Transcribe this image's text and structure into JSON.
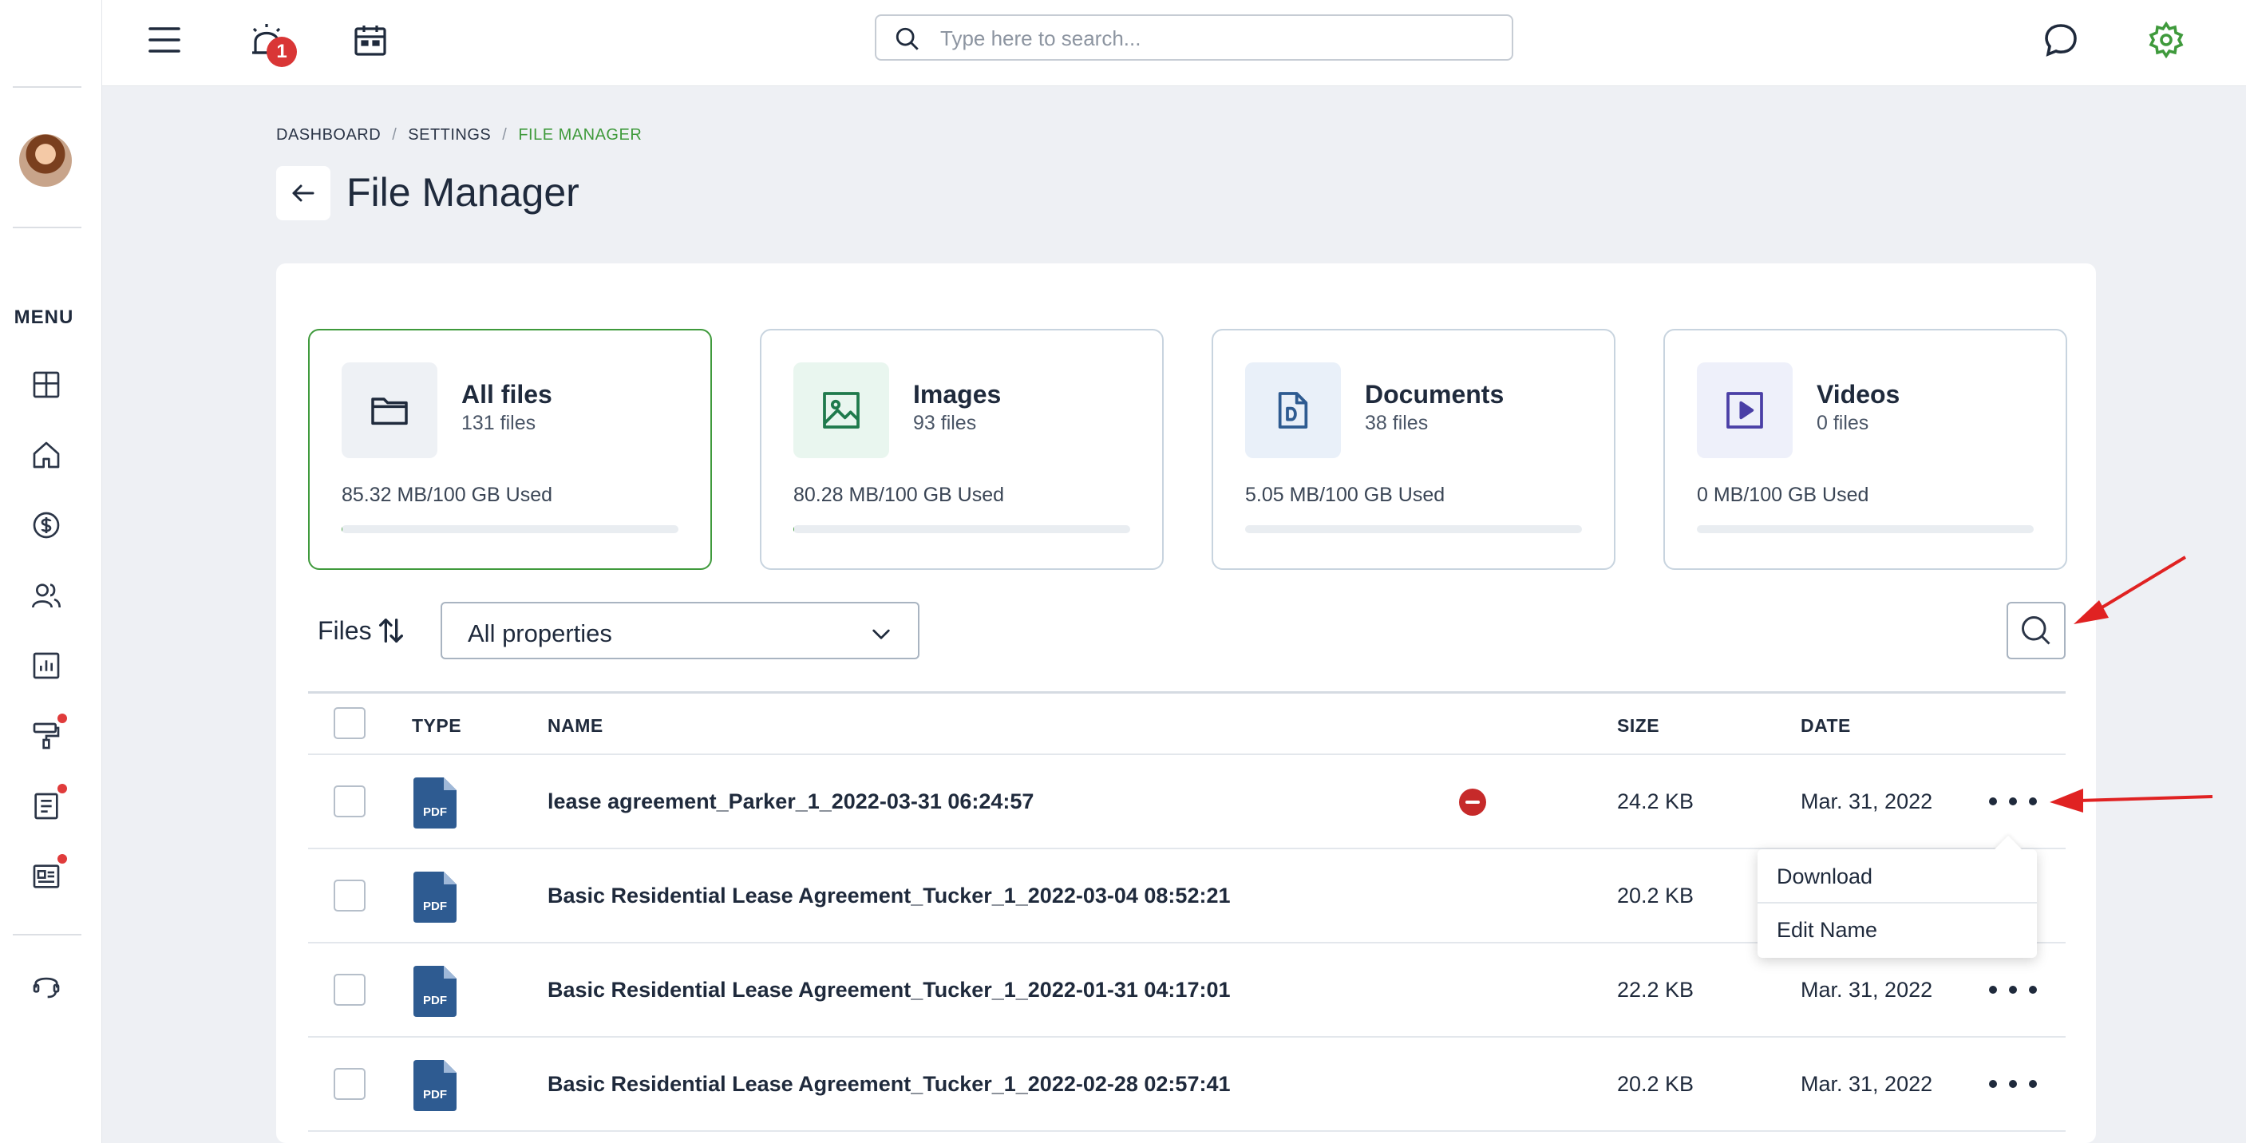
{
  "sidebar": {
    "menu_label": "MENU",
    "items": [
      {
        "icon": "dashboard-icon"
      },
      {
        "icon": "home-icon"
      },
      {
        "icon": "dollar-icon"
      },
      {
        "icon": "users-icon"
      },
      {
        "icon": "reports-icon"
      },
      {
        "icon": "maintenance-icon",
        "dot": true
      },
      {
        "icon": "notes-icon",
        "dot": true
      },
      {
        "icon": "listing-icon",
        "dot": true
      },
      {
        "icon": "support-icon"
      }
    ]
  },
  "topbar": {
    "notification_count": "1",
    "search_placeholder": "Type here to search...",
    "settings_color": "#3f9a3c"
  },
  "breadcrumb": {
    "items": [
      "DASHBOARD",
      "SETTINGS",
      "FILE MANAGER"
    ],
    "separator": "/"
  },
  "page": {
    "title": "File Manager"
  },
  "categories": [
    {
      "title": "All files",
      "count": "131 files",
      "used": "85.32 MB/100 GB Used",
      "used_fraction": 0.0009,
      "icon": "folder-icon",
      "active": true
    },
    {
      "title": "Images",
      "count": "93 files",
      "used": "80.28 MB/100 GB Used",
      "used_fraction": 0.0008,
      "icon": "image-icon"
    },
    {
      "title": "Documents",
      "count": "38 files",
      "used": "5.05 MB/100 GB Used",
      "used_fraction": 0.0001,
      "icon": "document-icon"
    },
    {
      "title": "Videos",
      "count": "0 files",
      "used": "0 MB/100 GB Used",
      "used_fraction": 0,
      "icon": "video-icon"
    }
  ],
  "files": {
    "label": "Files",
    "property_filter": "All properties",
    "columns": {
      "type": "TYPE",
      "name": "NAME",
      "size": "SIZE",
      "date": "DATE"
    },
    "file_type_label": "PDF",
    "rows": [
      {
        "name": "lease agreement_Parker_1_2022-03-31 06:24:57",
        "size": "24.2 KB",
        "date": "Mar. 31, 2022",
        "has_remove": true
      },
      {
        "name": "Basic Residential Lease Agreement_Tucker_1_2022-03-04 08:52:21",
        "size": "20.2 KB",
        "date": ""
      },
      {
        "name": "Basic Residential Lease Agreement_Tucker_1_2022-01-31 04:17:01",
        "size": "22.2 KB",
        "date": "Mar. 31, 2022"
      },
      {
        "name": "Basic Residential Lease Agreement_Tucker_1_2022-02-28 02:57:41",
        "size": "20.2 KB",
        "date": "Mar. 31, 2022"
      }
    ]
  },
  "row_menu": {
    "download": "Download",
    "edit_name": "Edit Name"
  },
  "colors": {
    "accent": "#3f9a3c",
    "pdf": "#2e5b91",
    "annotation": "#e02222"
  }
}
